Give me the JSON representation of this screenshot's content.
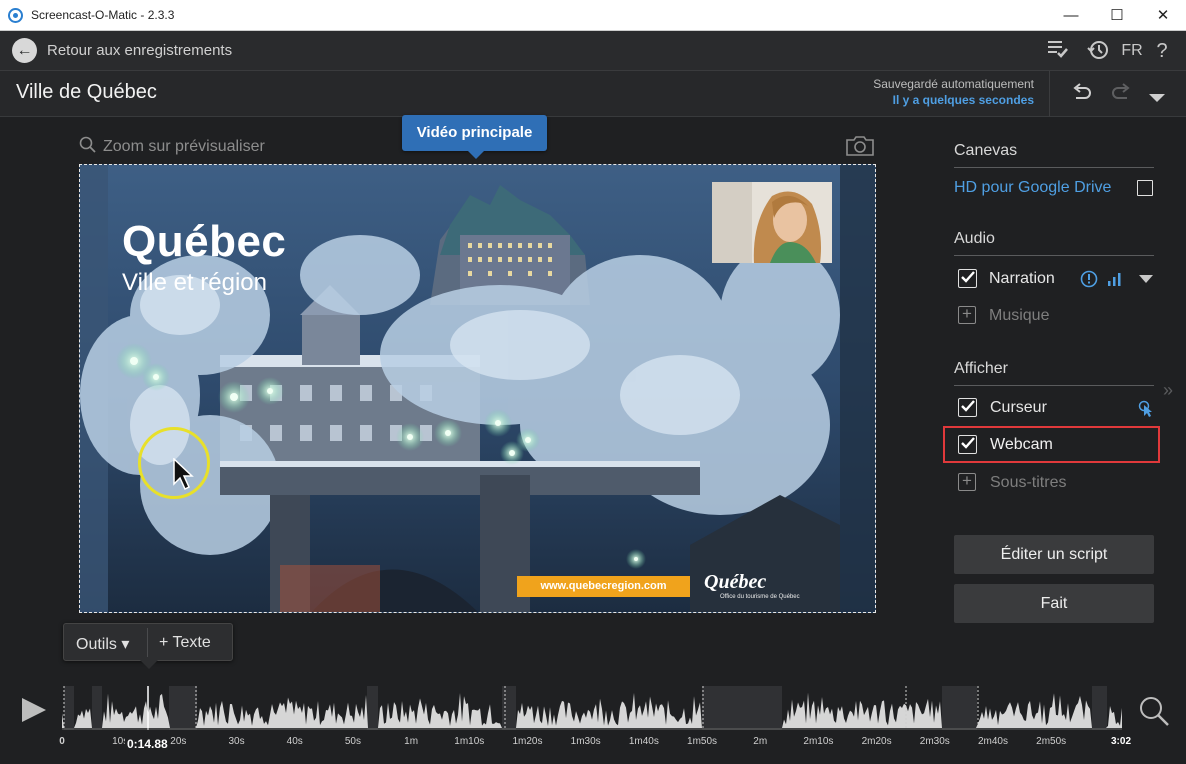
{
  "window": {
    "title": "Screencast-O-Matic - 2.3.3",
    "minimize": "—",
    "maximize": "☐",
    "close": "✕"
  },
  "nav": {
    "back_label": "Retour aux enregistrements",
    "lang": "FR",
    "help": "?"
  },
  "project": {
    "title": "Ville de Québec",
    "autosave_line1": "Sauvegardé automatiquement",
    "autosave_line2": "Il y a quelques secondes"
  },
  "preview": {
    "zoom_label": "Zoom sur prévisualiser",
    "tooltip": "Vidéo principale",
    "overlay_title": "Québec",
    "overlay_subtitle": "Ville et région",
    "url_banner": "www.quebecregion.com",
    "logo_text": "Québec",
    "logo_subtext": "Office du tourisme de Québec"
  },
  "tools": {
    "outils": "Outils ▾",
    "texte": "+ Texte"
  },
  "panel": {
    "canevas_header": "Canevas",
    "canevas_option": "HD pour Google Drive",
    "canevas_checked": false,
    "audio_header": "Audio",
    "narration": "Narration",
    "narration_checked": true,
    "musique": "Musique",
    "afficher_header": "Afficher",
    "curseur": "Curseur",
    "curseur_checked": true,
    "webcam": "Webcam",
    "webcam_checked": true,
    "sous_titres": "Sous-titres",
    "edit_script": "Éditer un script",
    "done": "Fait",
    "link_color": "#4f9fe3",
    "highlight_color": "#e0393b"
  },
  "timeline": {
    "current_time": "0:14.88",
    "duration_label": "3:02",
    "labels": [
      "0",
      "10s",
      "20s",
      "30s",
      "40s",
      "50s",
      "1m",
      "1m10s",
      "1m20s",
      "1m30s",
      "1m40s",
      "1m50s",
      "2m",
      "2m10s",
      "2m20s",
      "2m30s",
      "2m40s",
      "2m50s",
      "3:02"
    ]
  }
}
